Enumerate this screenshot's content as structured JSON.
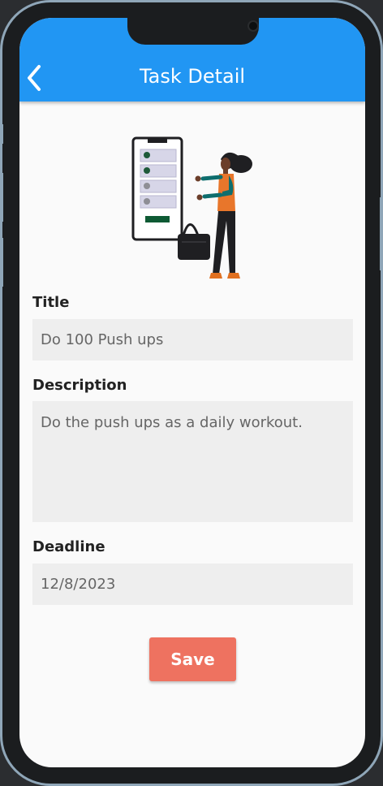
{
  "appbar": {
    "back_icon": "chevron-left-icon",
    "title": "Task Detail",
    "color": "#2196f3"
  },
  "form": {
    "title_label": "Title",
    "title_value": "Do 100 Push ups",
    "description_label": "Description",
    "description_value": "Do the push ups as a daily workout.",
    "deadline_label": "Deadline",
    "deadline_value": "12/8/2023"
  },
  "actions": {
    "save_label": "Save",
    "save_color": "#ee7260"
  }
}
